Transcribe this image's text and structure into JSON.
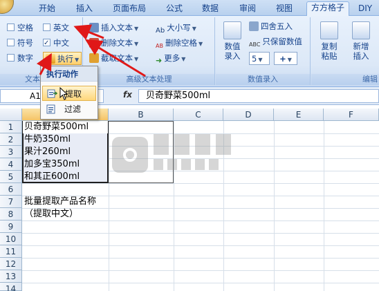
{
  "tabs": [
    "开始",
    "插入",
    "页面布局",
    "公式",
    "数据",
    "审阅",
    "视图",
    "方方格子",
    "DIY"
  ],
  "active_tab_index": 7,
  "ribbon": {
    "text_group": {
      "label": "文本",
      "checkboxes": [
        {
          "label": "空格",
          "checked": false
        },
        {
          "label": "英文",
          "checked": false
        },
        {
          "label": "符号",
          "checked": false
        },
        {
          "label": "中文",
          "checked": true
        },
        {
          "label": "数字",
          "checked": false
        }
      ],
      "execute_label": "执行"
    },
    "advanced_group": {
      "label": "高级文本处理",
      "items": [
        "插入文本",
        "删除文本",
        "截取文本",
        "大小写",
        "删除空格",
        "更多"
      ]
    },
    "value_group": {
      "label": "数值录入",
      "big_button": "数值\n录入",
      "items": [
        "四舍五入",
        "只保留数值"
      ],
      "spinner_value": "5"
    },
    "edit_group": {
      "label": "编辑",
      "buttons": [
        "复制\n粘贴",
        "新增\n插入"
      ]
    }
  },
  "formula_bar": {
    "name_box": "A1",
    "fx": "fx",
    "content": "贝奇野菜500ml"
  },
  "columns": [
    "A",
    "B",
    "C",
    "D",
    "E",
    "F"
  ],
  "rows": [
    "1",
    "2",
    "3",
    "4",
    "5",
    "6",
    "7",
    "8",
    "9",
    "10",
    "11",
    "12",
    "13",
    "14"
  ],
  "cells": {
    "a1": "贝奇野菜500ml",
    "a2": "牛奶350ml",
    "a3": "果汁260ml",
    "a4": "加多宝350ml",
    "a5": "和其正600ml",
    "a7": "批量提取产品名称",
    "a8": "（提取中文）"
  },
  "dropdown": {
    "title": "执行动作",
    "items": [
      "提取",
      "过滤"
    ]
  },
  "colors": {
    "arrow": "#e01818",
    "accent": "#15428b"
  }
}
